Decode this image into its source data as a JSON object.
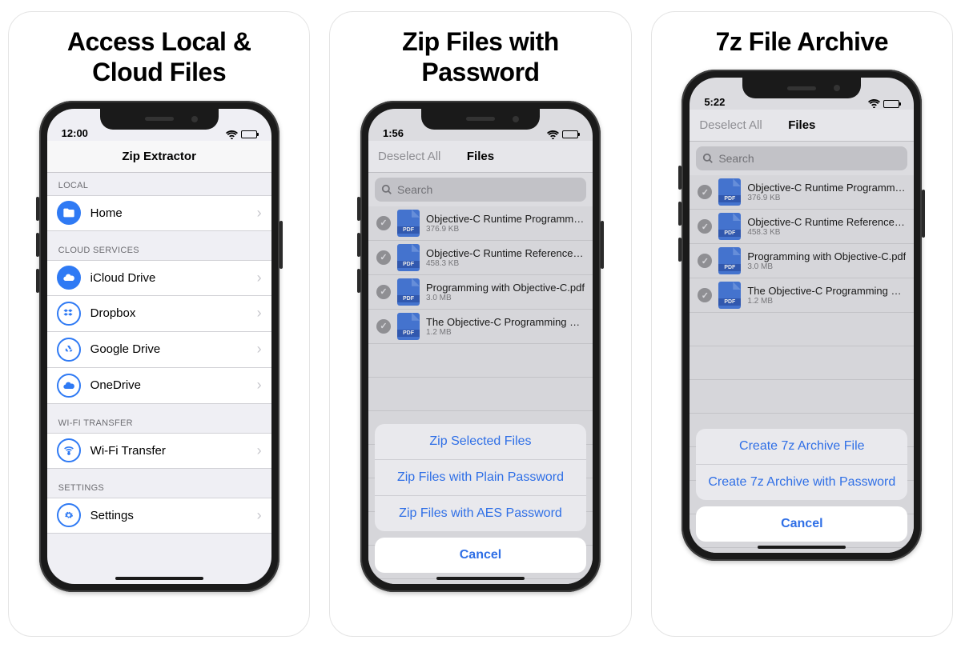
{
  "cards": [
    {
      "headline": "Access Local &\nCloud Files"
    },
    {
      "headline": "Zip Files with\nPassword"
    },
    {
      "headline": "7z File Archive"
    }
  ],
  "screen1": {
    "time": "12:00",
    "title": "Zip Extractor",
    "sections": {
      "local_header": "LOCAL",
      "home": "Home",
      "cloud_header": "CLOUD SERVICES",
      "icloud": "iCloud Drive",
      "dropbox": "Dropbox",
      "gdrive": "Google Drive",
      "onedrive": "OneDrive",
      "wifi_header": "WI-FI TRANSFER",
      "wifi": "Wi-Fi Transfer",
      "settings_header": "SETTINGS",
      "settings": "Settings"
    }
  },
  "screen2": {
    "time": "1:56",
    "nav_left": "Deselect All",
    "title": "Files",
    "search_placeholder": "Search",
    "files": [
      {
        "name": "Objective-C Runtime Programmin…",
        "size": "376.9 KB"
      },
      {
        "name": "Objective-C Runtime Reference.pdf",
        "size": "458.3 KB"
      },
      {
        "name": "Programming with Objective-C.pdf",
        "size": "3.0 MB"
      },
      {
        "name": "The Objective-C Programming Lan…",
        "size": "1.2 MB"
      }
    ],
    "actions": [
      "Zip Selected Files",
      "Zip Files with Plain Password",
      "Zip Files with AES Password"
    ],
    "cancel": "Cancel"
  },
  "screen3": {
    "time": "5:22",
    "nav_left": "Deselect All",
    "title": "Files",
    "search_placeholder": "Search",
    "files": [
      {
        "name": "Objective-C Runtime Programmin…",
        "size": "376.9 KB"
      },
      {
        "name": "Objective-C Runtime Reference.pdf",
        "size": "458.3 KB"
      },
      {
        "name": "Programming with Objective-C.pdf",
        "size": "3.0 MB"
      },
      {
        "name": "The Objective-C Programming Lan…",
        "size": "1.2 MB"
      }
    ],
    "actions": [
      "Create 7z Archive File",
      "Create 7z Archive with Password"
    ],
    "cancel": "Cancel"
  }
}
